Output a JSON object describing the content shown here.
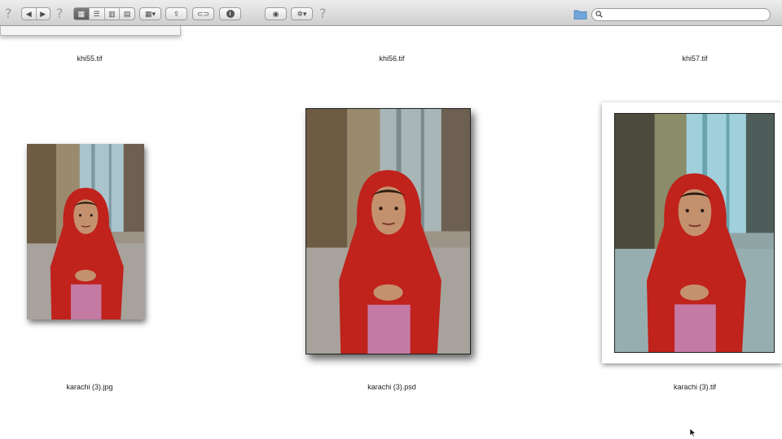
{
  "toolbar": {
    "help_glyph": "?",
    "nav_back": "◀",
    "nav_forward": "▶",
    "view_icons": "▦",
    "view_list": "☰",
    "view_columns": "▥",
    "view_coverflow": "▤",
    "arrange_glyph": "▦▾",
    "share_glyph": "⇪",
    "tag_glyph": "⊂⊃",
    "info_glyph": "i",
    "quicklook_glyph": "◉",
    "action_glyph": "✲▾",
    "search_placeholder": ""
  },
  "files": {
    "top_row": [
      {
        "name": "khi55.tif"
      },
      {
        "name": "khi56.tif"
      },
      {
        "name": "khi57.tif"
      }
    ],
    "main_row": [
      {
        "name": "karachi (3).jpg"
      },
      {
        "name": "karachi (3).psd"
      },
      {
        "name": "karachi (3).tif"
      }
    ]
  },
  "colors": {
    "scarf_red": "#c0221c",
    "dress_pink": "#c47aa3",
    "wall_blue": "#a9c4cc",
    "wall_brown": "#8a7355"
  }
}
